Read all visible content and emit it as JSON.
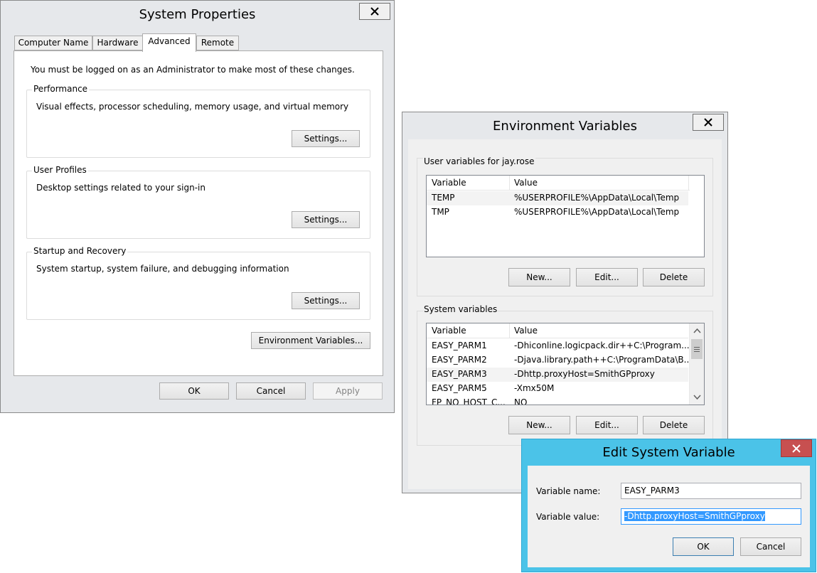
{
  "system_properties": {
    "title": "System Properties",
    "tabs": [
      "Computer Name",
      "Hardware",
      "Advanced",
      "Remote"
    ],
    "active_tab": "Advanced",
    "admin_note": "You must be logged on as an Administrator to make most of these changes.",
    "performance": {
      "title": "Performance",
      "description": "Visual effects, processor scheduling, memory usage, and virtual memory",
      "button": "Settings..."
    },
    "user_profiles": {
      "title": "User Profiles",
      "description": "Desktop settings related to your sign-in",
      "button": "Settings..."
    },
    "startup_recovery": {
      "title": "Startup and Recovery",
      "description": "System startup, system failure, and debugging information",
      "button": "Settings..."
    },
    "env_button": "Environment Variables...",
    "ok": "OK",
    "cancel": "Cancel",
    "apply": "Apply"
  },
  "environment_variables": {
    "title": "Environment Variables",
    "user_group": "User variables for jay.rose",
    "columns": [
      "Variable",
      "Value"
    ],
    "user_rows": [
      {
        "variable": "TEMP",
        "value": "%USERPROFILE%\\AppData\\Local\\Temp"
      },
      {
        "variable": "TMP",
        "value": "%USERPROFILE%\\AppData\\Local\\Temp"
      }
    ],
    "system_group": "System variables",
    "system_rows": [
      {
        "variable": "EASY_PARM1",
        "value": "-Dhiconline.logicpack.dir++C:\\Program..."
      },
      {
        "variable": "EASY_PARM2",
        "value": "-Djava.library.path++C:\\ProgramData\\B..."
      },
      {
        "variable": "EASY_PARM3",
        "value": "-Dhttp.proxyHost=SmithGPproxy"
      },
      {
        "variable": "EASY_PARM5",
        "value": "-Xmx50M"
      },
      {
        "variable": "FP_NO_HOST_C...",
        "value": "NO"
      }
    ],
    "new": "New...",
    "edit": "Edit...",
    "delete": "Delete"
  },
  "edit_system_variable": {
    "title": "Edit System Variable",
    "name_label": "Variable name:",
    "name_value": "EASY_PARM3",
    "value_label": "Variable value:",
    "value_value": "-Dhttp.proxyHost=SmithGPproxy",
    "ok": "OK",
    "cancel": "Cancel",
    "accent_color": "#4bc3e8",
    "close_color": "#c75050"
  }
}
